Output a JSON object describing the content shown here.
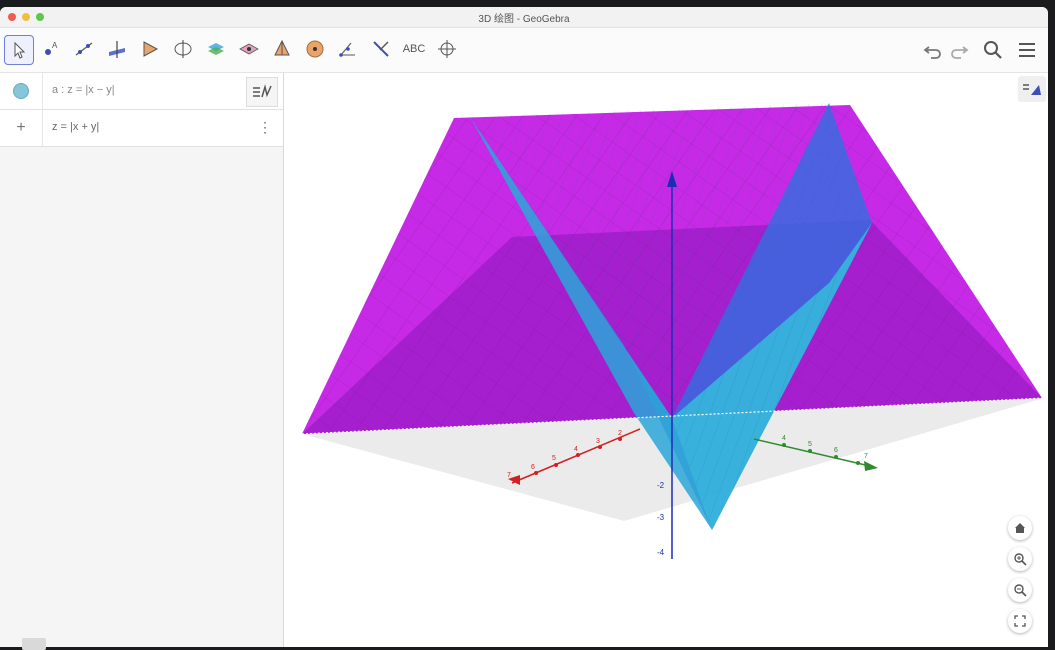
{
  "window": {
    "title": "3D 绘图 - GeoGebra"
  },
  "toolbar": {
    "tools": [
      {
        "icon": "move-arrow-icon"
      },
      {
        "icon": "point-icon"
      },
      {
        "icon": "line-icon"
      },
      {
        "icon": "perpendicular-icon"
      },
      {
        "icon": "polygon-icon"
      },
      {
        "icon": "circle-axis-icon"
      },
      {
        "icon": "intersect-surfaces-icon"
      },
      {
        "icon": "plane-icon"
      },
      {
        "icon": "pyramid-icon"
      },
      {
        "icon": "sphere-icon"
      },
      {
        "icon": "angle-icon"
      },
      {
        "icon": "reflect-icon"
      },
      {
        "icon": "text-icon",
        "label": "ABC"
      },
      {
        "icon": "rotate-view-icon"
      }
    ],
    "right": [
      "undo-icon",
      "redo-icon",
      "search-icon",
      "menu-icon"
    ]
  },
  "algebra": {
    "rows": [
      {
        "expression": "a : z = |x − y|",
        "color": "#86c6d9"
      },
      {
        "expression": "z = |x + y|"
      }
    ]
  },
  "graphics": {
    "z_axis_labels": [
      "-2",
      "-3",
      "-4"
    ],
    "x_axis_labels": [
      "7",
      "6",
      "5",
      "4",
      "3",
      "2"
    ],
    "y_axis_labels": [
      "4",
      "5",
      "6",
      "7"
    ],
    "surface_colors": {
      "plane": "#c020e0",
      "surface": "#2aa7d8"
    }
  }
}
